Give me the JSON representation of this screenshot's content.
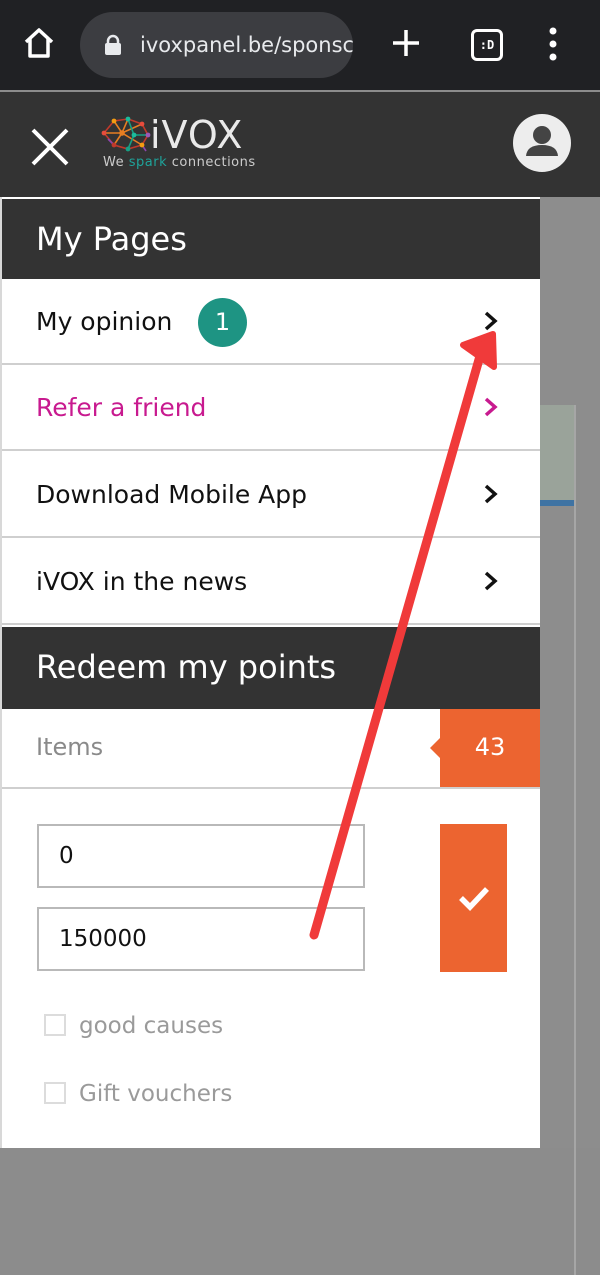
{
  "browser": {
    "url": "ivoxpanel.be/sponsc",
    "tab_count_label": ":D"
  },
  "header": {
    "logo_word": "iVOX",
    "tagline_pre": "We ",
    "tagline_spark": "spark",
    "tagline_post": " connections"
  },
  "my_pages": {
    "title": "My Pages",
    "items": [
      {
        "label": "My opinion",
        "badge": "1"
      },
      {
        "label": "Refer a friend"
      },
      {
        "label": "Download Mobile App"
      },
      {
        "label": "iVOX in the news"
      }
    ]
  },
  "redeem": {
    "title": "Redeem my points",
    "items_label": "Items",
    "items_count": "43",
    "min_value": "0",
    "max_value": "150000",
    "filters": [
      {
        "label": "good causes",
        "checked": false
      },
      {
        "label": "Gift vouchers",
        "checked": false
      }
    ]
  },
  "colors": {
    "accent_orange": "#ec6430",
    "badge_green": "#1e9483",
    "refer_magenta": "#c81a8f",
    "header_dark": "#333333",
    "annotation_red": "#f03a3a"
  },
  "icons": [
    "home-icon",
    "lock-icon",
    "new-tab-icon",
    "tab-switcher-icon",
    "overflow-menu-icon",
    "close-icon",
    "ivox-brain-logo",
    "user-avatar-icon",
    "chevron-right-icon",
    "checkmark-icon"
  ]
}
